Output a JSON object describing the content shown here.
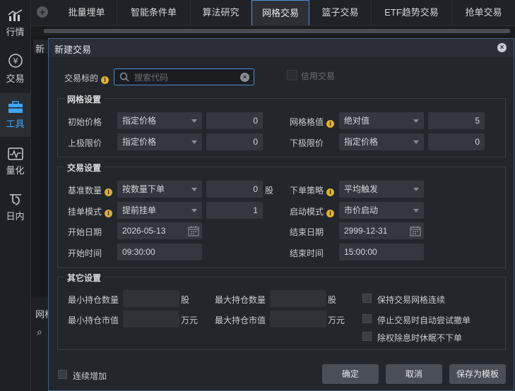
{
  "sidebar": {
    "items": [
      {
        "label": "行情",
        "icon": "chart-bars-icon"
      },
      {
        "label": "交易",
        "icon": "yen-circle-icon"
      },
      {
        "label": "工具",
        "icon": "toolbox-icon"
      },
      {
        "label": "量化",
        "icon": "waveform-icon"
      },
      {
        "label": "日内",
        "icon": "intraday-icon"
      }
    ]
  },
  "tabs": [
    {
      "label": "批量埋单"
    },
    {
      "label": "智能条件单"
    },
    {
      "label": "算法研究"
    },
    {
      "label": "网格交易"
    },
    {
      "label": "篮子交易"
    },
    {
      "label": "ETF趋势交易"
    },
    {
      "label": "抢单交易"
    }
  ],
  "background": {
    "panel1_label": "新",
    "panel2_label": "网格"
  },
  "modal": {
    "title": "新建交易",
    "target_label": "交易标的",
    "search_placeholder": "搜索代码",
    "credit_label": "信用交易",
    "grid_settings": {
      "title": "网格设置",
      "init_price_label": "初始价格",
      "init_price_mode": "指定价格",
      "init_price_value": "0",
      "grid_value_label": "网格格值",
      "grid_value_mode": "绝对值",
      "grid_value_value": "5",
      "upper_label": "上极限价",
      "upper_mode": "指定价格",
      "upper_value": "0",
      "lower_label": "下极限价",
      "lower_mode": "指定价格",
      "lower_value": "0"
    },
    "trade_settings": {
      "title": "交易设置",
      "base_qty_label": "基准数量",
      "base_qty_mode": "按数量下单",
      "base_qty_value": "0",
      "base_qty_unit": "股",
      "order_strategy_label": "下单策略",
      "order_strategy_value": "平均触发",
      "pending_mode_label": "挂单模式",
      "pending_mode_value": "提前挂单",
      "pending_count": "1",
      "start_mode_label": "启动模式",
      "start_mode_value": "市价启动",
      "start_date_label": "开始日期",
      "start_date": "2026-05-13",
      "end_date_label": "结束日期",
      "end_date": "2999-12-31",
      "start_time_label": "开始时间",
      "start_time": "09:30:00",
      "end_time_label": "结束时间",
      "end_time": "15:00:00"
    },
    "other_settings": {
      "title": "其它设置",
      "min_qty_label": "最小持仓数量",
      "min_qty_unit": "股",
      "max_qty_label": "最大持仓数量",
      "max_qty_unit": "股",
      "min_value_label": "最小持仓市值",
      "min_value_unit": "万元",
      "max_value_label": "最大持仓市值",
      "max_value_unit": "万元",
      "keep_grid_label": "保持交易网格连续",
      "cancel_on_stop_label": "停止交易时自动尝试撤单",
      "dividend_label": "除权除息时休眠不下单"
    },
    "footer": {
      "continuous_add_label": "连续增加",
      "confirm_label": "确定",
      "cancel_label": "取消",
      "save_template_label": "保存为模板"
    }
  }
}
